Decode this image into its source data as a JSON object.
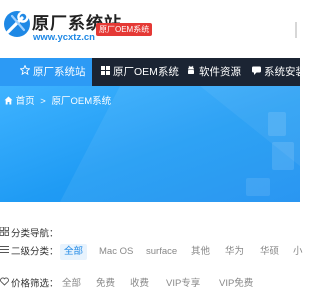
{
  "header": {
    "logo_title": "原厂系统站",
    "logo_url": "www.ycxtz.cn",
    "badge": "原厂OEM系统",
    "brand_color": "#1e88e5",
    "badge_color": "#e53935"
  },
  "nav": {
    "items": [
      {
        "label": "原厂系统站",
        "icon": "star-icon",
        "active": true
      },
      {
        "label": "原厂OEM系统",
        "icon": "windows-icon"
      },
      {
        "label": "软件资源",
        "icon": "android-icon"
      },
      {
        "label": "系统安装",
        "icon": "chat-icon"
      }
    ],
    "background": "#1b2433",
    "active_color": "#2c9af5"
  },
  "breadcrumb": {
    "home": "首页",
    "separator": ">",
    "current": "原厂OEM系统"
  },
  "filters": {
    "nav_label": "分类导航：",
    "sub_label": "二级分类：",
    "sub_options": [
      "全部",
      "Mac OS",
      "surface",
      "其他",
      "华为",
      "华硕",
      "小"
    ],
    "price_label": "价格筛选：",
    "price_options": [
      "全部",
      "免费",
      "收费",
      "VIP专享",
      "VIP免费"
    ]
  }
}
